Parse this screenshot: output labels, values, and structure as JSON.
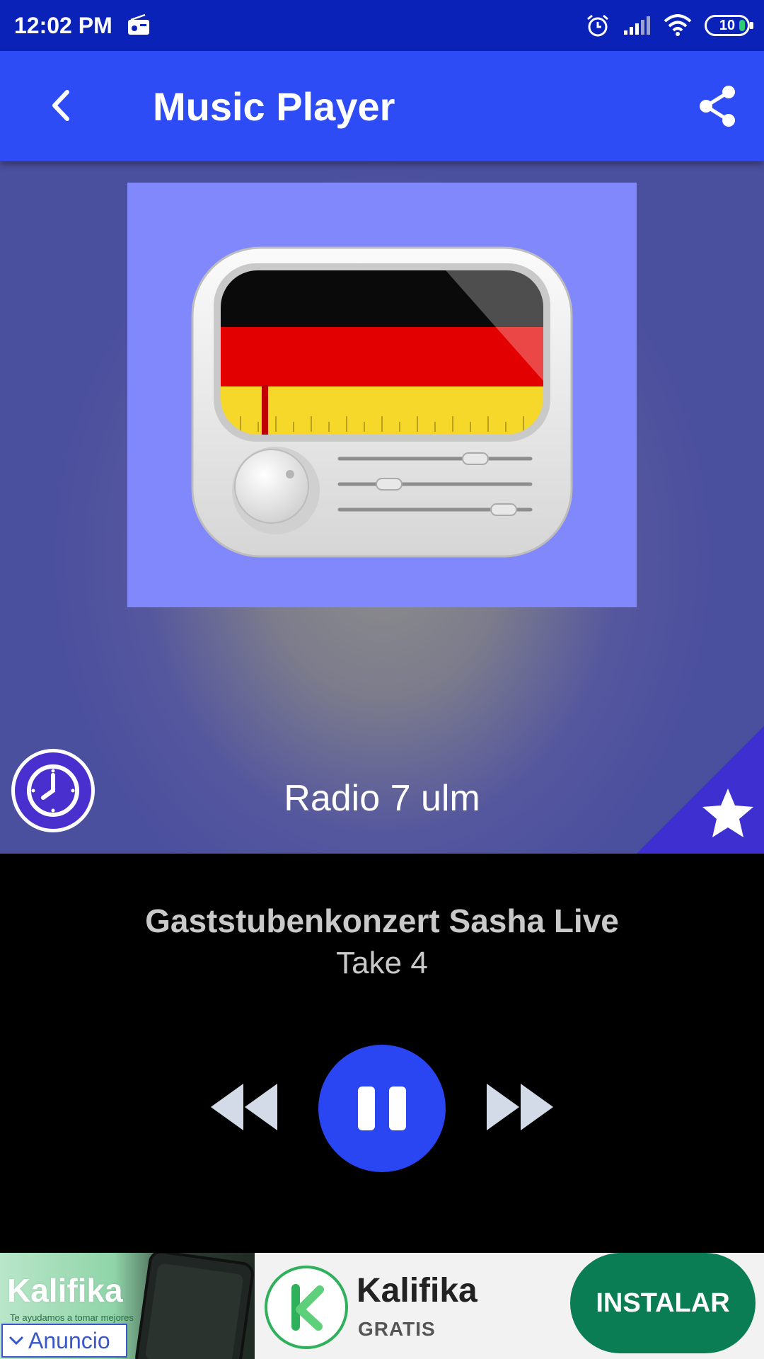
{
  "status_bar": {
    "time": "12:02 PM",
    "battery_level": "10",
    "icons": [
      "radio-icon",
      "alarm-icon",
      "signal-icon",
      "wifi-icon",
      "battery-icon"
    ]
  },
  "app_bar": {
    "title": "Music Player",
    "back_icon": "chevron-left-icon",
    "share_icon": "share-icon"
  },
  "player": {
    "station_name": "Radio 7 ulm",
    "artwork": "germany-radio-icon",
    "timer_icon": "clock-icon",
    "favorite_icon": "star-icon",
    "colors": {
      "accent": "#2e4cf5",
      "status_bar": "#0a22b8",
      "artwork_bg": "#8088fc"
    }
  },
  "now_playing": {
    "track_title": "Gaststubenkonzert Sasha Live",
    "track_subtitle": "Take 4",
    "controls": [
      "rewind-icon",
      "pause-icon",
      "fast-forward-icon"
    ]
  },
  "ad": {
    "image_brand": "Kalifika",
    "image_tagline": "Te ayudamos a tomar mejores",
    "label": "Anuncio",
    "app_name": "Kalifika",
    "price": "GRATIS",
    "cta": "INSTALAR",
    "colors": {
      "cta": "#0b7d55",
      "brand": "#2fb05a"
    }
  }
}
